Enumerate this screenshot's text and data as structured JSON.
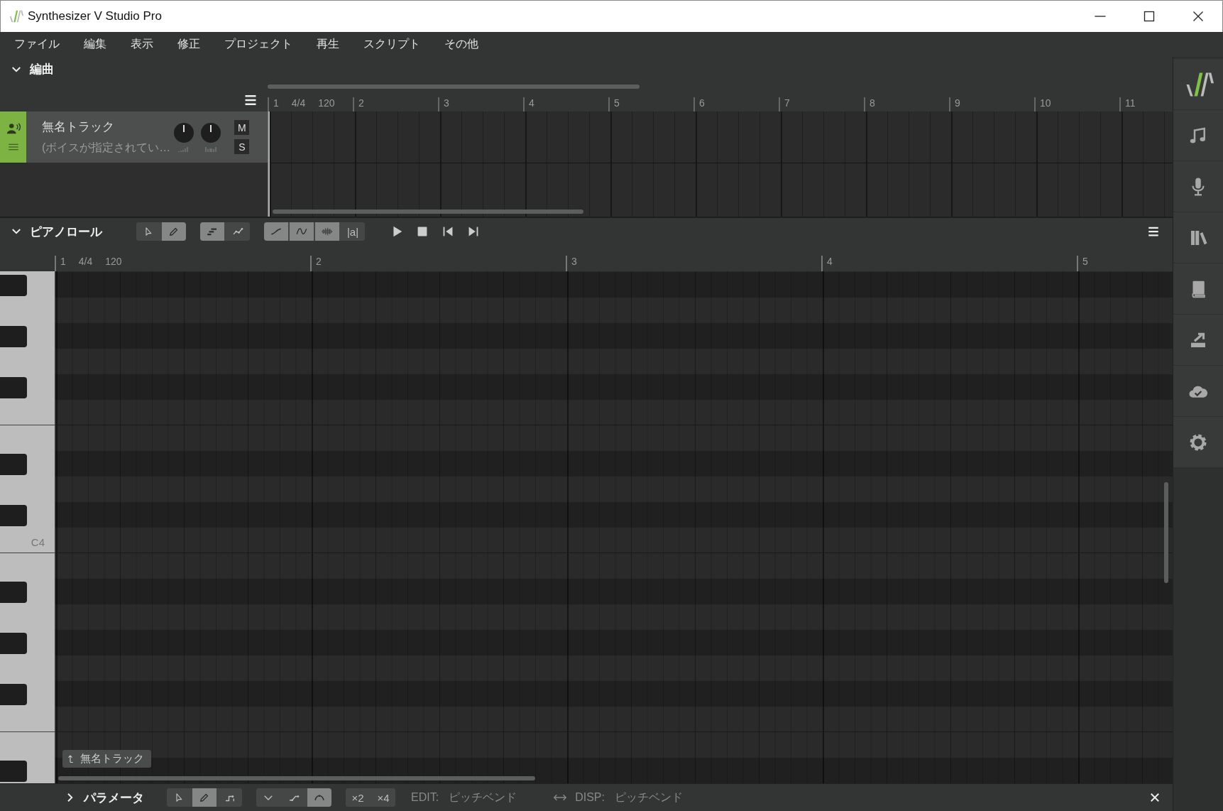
{
  "window": {
    "title": "Synthesizer V Studio Pro"
  },
  "menu": [
    "ファイル",
    "編集",
    "表示",
    "修正",
    "プロジェクト",
    "再生",
    "スクリプト",
    "その他"
  ],
  "arrangement": {
    "title": "編曲",
    "expanded": true,
    "ruler": {
      "bars": [
        "1",
        "2",
        "3",
        "4",
        "5",
        "6",
        "7",
        "8",
        "9",
        "10",
        "11"
      ],
      "time_signature": "4/4",
      "tempo": "120"
    },
    "tracks": [
      {
        "name": "無名トラック",
        "voice": "(ボイスが指定されてい…",
        "mute_label": "M",
        "solo_label": "S",
        "muted": false,
        "solo": false
      }
    ]
  },
  "piano_roll": {
    "title": "ピアノロール",
    "expanded": true,
    "tool_groups": [
      [
        {
          "kind": "select",
          "selected": false
        },
        {
          "kind": "pencil",
          "selected": true
        }
      ],
      [
        {
          "kind": "notes",
          "selected": true
        },
        {
          "kind": "curve",
          "selected": false
        }
      ],
      [
        {
          "kind": "pitch",
          "selected": true
        },
        {
          "kind": "vibrato",
          "selected": true
        },
        {
          "kind": "waveform",
          "selected": true
        },
        {
          "kind": "text",
          "label": "|a|",
          "selected": false
        }
      ]
    ],
    "ruler": {
      "bars": [
        "1",
        "2",
        "3",
        "4",
        "5"
      ],
      "time_signature": "4/4",
      "tempo": "120"
    },
    "key_label": "C4",
    "track_tag": "無名トラック"
  },
  "parameters": {
    "title": "パラメータ",
    "expanded": false,
    "tool_groups": [
      [
        {
          "kind": "select",
          "selected": false
        },
        {
          "kind": "pencil",
          "selected": true
        },
        {
          "kind": "step",
          "selected": false
        }
      ],
      [
        {
          "kind": "dip",
          "selected": false
        },
        {
          "kind": "rise",
          "selected": false
        },
        {
          "kind": "arch",
          "selected": true
        }
      ],
      [
        {
          "kind": "text",
          "label": "×2",
          "selected": false
        },
        {
          "kind": "text",
          "label": "×4",
          "selected": false
        }
      ]
    ],
    "edit_label": "EDIT:",
    "edit_value": "ピッチベンド",
    "disp_label": "DISP:",
    "disp_value": "ピッチベンド"
  },
  "sidebar": [
    {
      "kind": "logo"
    },
    {
      "kind": "note"
    },
    {
      "kind": "microphone"
    },
    {
      "kind": "books"
    },
    {
      "kind": "book"
    },
    {
      "kind": "export"
    },
    {
      "kind": "cloud"
    },
    {
      "kind": "gear"
    }
  ]
}
